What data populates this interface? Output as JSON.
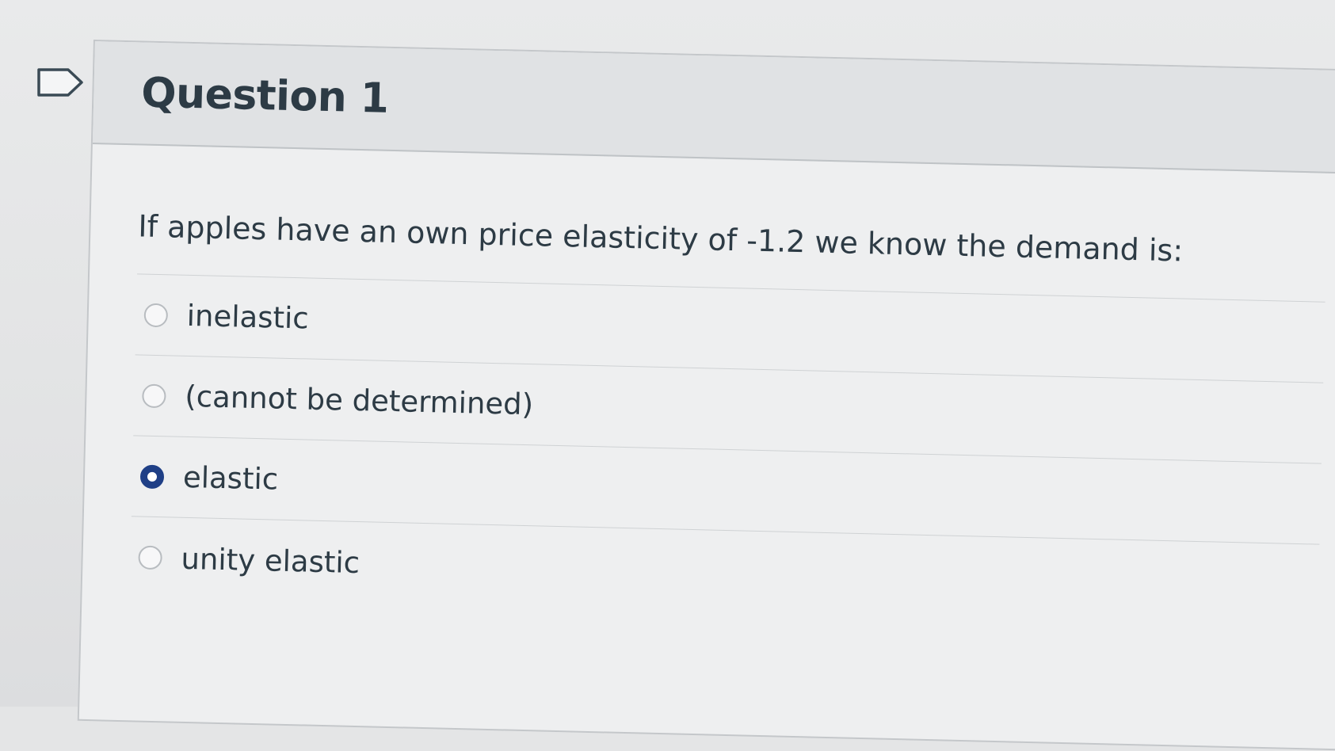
{
  "question": {
    "title": "Question 1",
    "text": "If apples have an own price elasticity of -1.2 we know the demand is:",
    "answers": [
      {
        "label": "inelastic",
        "selected": false
      },
      {
        "label": "(cannot be determined)",
        "selected": false
      },
      {
        "label": "elastic",
        "selected": true
      },
      {
        "label": "unity elastic",
        "selected": false
      }
    ]
  },
  "icons": {
    "flag": "flag-icon"
  },
  "colors": {
    "selected_radio": "#1f3f86",
    "text": "#2d3b45"
  }
}
